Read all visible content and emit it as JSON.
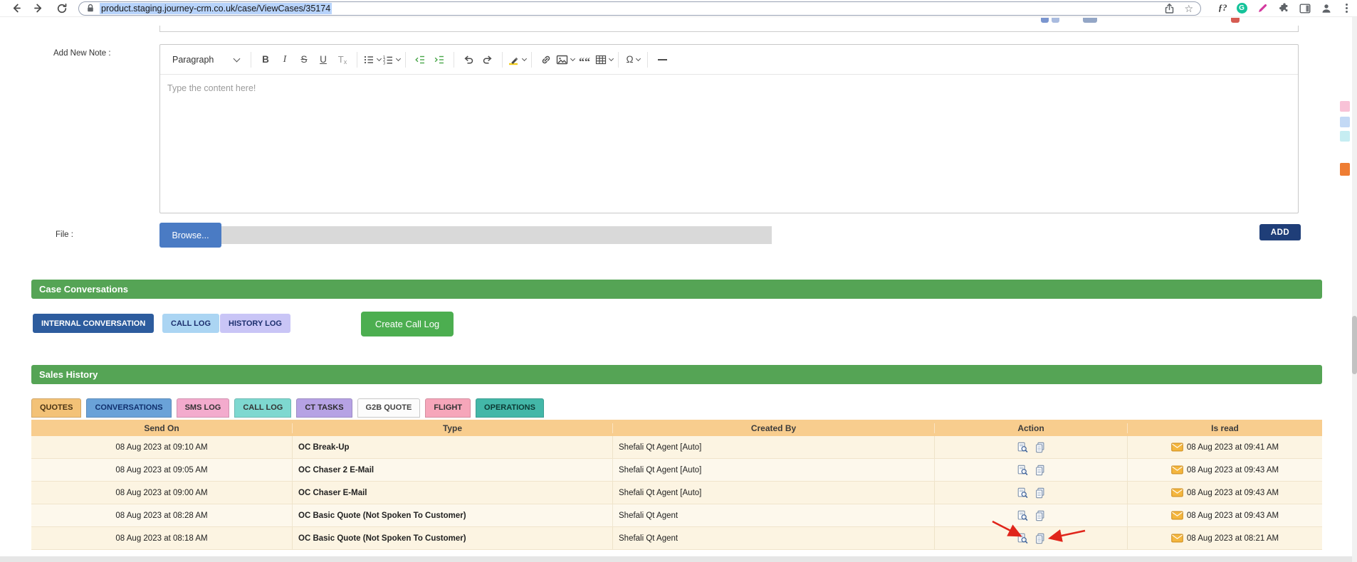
{
  "browser": {
    "url": "product.staging.journey-crm.co.uk/case/ViewCases/35174",
    "star_glyph": "☆",
    "fonts_badge": "ƒ?",
    "grammarly_badge": "G"
  },
  "note": {
    "label": "Add New Note :",
    "file_label": "File :",
    "browse_label": "Browse...",
    "add_label": "ADD",
    "editor": {
      "paragraph_label": "Paragraph",
      "bold": "B",
      "italic": "I",
      "strikethrough": "S",
      "underline": "U",
      "remove_format_t": "T",
      "remove_format_x": "x",
      "quote": "““",
      "omega": "Ω",
      "placeholder": "Type the content here!"
    }
  },
  "case_conversations": {
    "title": "Case Conversations",
    "buttons": [
      "INTERNAL CONVERSATION",
      "CALL LOG",
      "HISTORY LOG"
    ],
    "create_call_log": "Create Call Log"
  },
  "sales_history": {
    "title": "Sales History",
    "active_tab": "QUOTES",
    "tabs": [
      "QUOTES",
      "CONVERSATIONS",
      "SMS LOG",
      "CALL LOG",
      "CT TASKS",
      "G2B QUOTE",
      "FLIGHT",
      "OPERATIONS"
    ],
    "table": {
      "headers": [
        "Send On",
        "Type",
        "Created By",
        "Action",
        "Is read"
      ],
      "rows": [
        {
          "send_on": "08 Aug 2023 at 09:10 AM",
          "type": "OC Break-Up",
          "created_by": "Shefali Qt Agent [Auto]",
          "is_read": "08 Aug 2023 at 09:41 AM"
        },
        {
          "send_on": "08 Aug 2023 at 09:05 AM",
          "type": "OC Chaser 2 E-Mail",
          "created_by": "Shefali Qt Agent [Auto]",
          "is_read": "08 Aug 2023 at 09:43 AM"
        },
        {
          "send_on": "08 Aug 2023 at 09:00 AM",
          "type": "OC Chaser E-Mail",
          "created_by": "Shefali Qt Agent [Auto]",
          "is_read": "08 Aug 2023 at 09:43 AM"
        },
        {
          "send_on": "08 Aug 2023 at 08:28 AM",
          "type": "OC Basic Quote (Not Spoken To Customer)",
          "created_by": "Shefali Qt Agent",
          "is_read": "08 Aug 2023 at 09:43 AM"
        },
        {
          "send_on": "08 Aug 2023 at 08:18 AM",
          "type": "OC Basic Quote (Not Spoken To Customer)",
          "created_by": "Shefali Qt Agent",
          "is_read": "08 Aug 2023 at 08:21 AM"
        }
      ]
    }
  },
  "annotations": {
    "red_arrows_target": "action icons of last table row",
    "arrow_count": 2
  },
  "colors": {
    "section_header_green": "#55a455",
    "table_header_tan": "#f8cd8e",
    "row_cream_odd": "#fcf4e2",
    "row_cream_even": "#fdf8ec",
    "internal_conversation_blue": "#2d5c9e",
    "call_log_light_blue": "#abd5f3",
    "history_log_lavender": "#c9c5f6",
    "create_call_log_green": "#4cae50",
    "browse_blue": "#4a7bc4",
    "add_navy": "#1f3e78",
    "tab_quotes": "#f3c277",
    "tab_conversations": "#6aa2d8",
    "tab_sms_log": "#f3abcd",
    "tab_call_log": "#7ed8d0",
    "tab_ct_tasks": "#b6a2e4",
    "tab_g2b_quote": "#fcfcfc",
    "tab_flight": "#f6a6ba",
    "tab_operations": "#43b7a8",
    "annotation_red": "#e0251b",
    "envelope_orange": "#f4b63e",
    "grammarly_green": "#15c39a",
    "url_selection_blue": "#b7d3fb"
  },
  "icons": {
    "back-icon": "left-arrow",
    "forward-icon": "right-arrow",
    "refresh-icon": "circular-arrow",
    "lock-icon": "padlock",
    "share-icon": "box-with-up-arrow",
    "bookmark-star-icon": "☆",
    "extensions-puzzle-icon": "puzzle-piece",
    "sidebar-icon": "split-rectangle",
    "profile-icon": "person-silhouette",
    "menu-dots-icon": "vertical-ellipsis",
    "bullet-list-icon": "dotted-lines",
    "numbered-list-icon": "numbered-lines",
    "outdent-icon": "green-lines-left-arrow",
    "indent-icon": "green-lines-right-arrow",
    "undo-icon": "curved-left-arrow",
    "redo-icon": "curved-right-arrow",
    "highlight-icon": "marker-pen-yellow",
    "link-icon": "chain-links",
    "image-icon": "picture-frame",
    "blockquote-icon": "double-quote",
    "table-icon": "grid",
    "hr-icon": "horizontal-line",
    "preview-icon": "document-with-magnifier",
    "copy-icon": "stacked-documents",
    "read-envelope-icon": "orange-envelope"
  }
}
